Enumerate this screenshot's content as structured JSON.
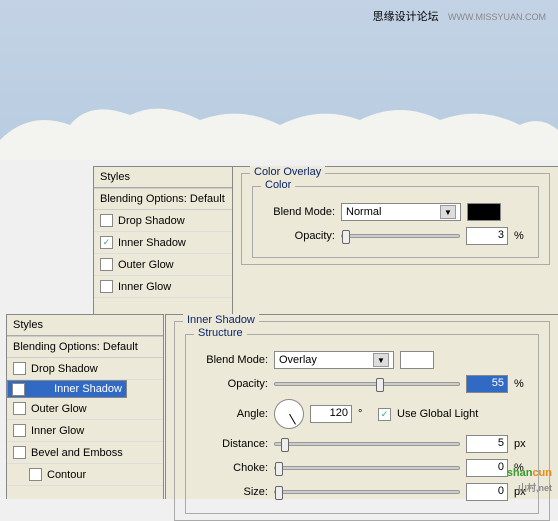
{
  "watermark": {
    "text1": "思缘设计论坛",
    "text2": "WWW.MISSYUAN.COM"
  },
  "styles1": {
    "header": "Styles",
    "blending": "Blending Options: Default",
    "items": [
      {
        "label": "Drop Shadow",
        "checked": false
      },
      {
        "label": "Inner Shadow",
        "checked": true
      },
      {
        "label": "Outer Glow",
        "checked": false
      },
      {
        "label": "Inner Glow",
        "checked": false
      }
    ]
  },
  "styles2": {
    "header": "Styles",
    "blending": "Blending Options: Default",
    "items": [
      {
        "label": "Drop Shadow",
        "checked": false,
        "sel": false
      },
      {
        "label": "Inner Shadow",
        "checked": true,
        "sel": true
      },
      {
        "label": "Outer Glow",
        "checked": false,
        "sel": false
      },
      {
        "label": "Inner Glow",
        "checked": false,
        "sel": false
      },
      {
        "label": "Bevel and Emboss",
        "checked": false,
        "sel": false
      },
      {
        "label": "Contour",
        "checked": false,
        "sel": false,
        "indent": true
      }
    ]
  },
  "colorOverlay": {
    "title": "Color Overlay",
    "section": "Color",
    "blendModeLabel": "Blend Mode:",
    "blendMode": "Normal",
    "opacityLabel": "Opacity:",
    "opacity": "3",
    "opacityUnit": "%"
  },
  "innerShadow": {
    "title": "Inner Shadow",
    "section": "Structure",
    "blendModeLabel": "Blend Mode:",
    "blendMode": "Overlay",
    "opacityLabel": "Opacity:",
    "opacity": "55",
    "opacityUnit": "%",
    "angleLabel": "Angle:",
    "angle": "120",
    "angleUnit": "°",
    "globalLight": "Use Global Light",
    "globalLightChecked": true,
    "distanceLabel": "Distance:",
    "distance": "5",
    "chokeLabel": "Choke:",
    "choke": "0",
    "sizeLabel": "Size:",
    "size": "0",
    "pxUnit": "px",
    "pctUnit": "%"
  },
  "logo": {
    "text": "shancun",
    "sub": "山村,net"
  }
}
